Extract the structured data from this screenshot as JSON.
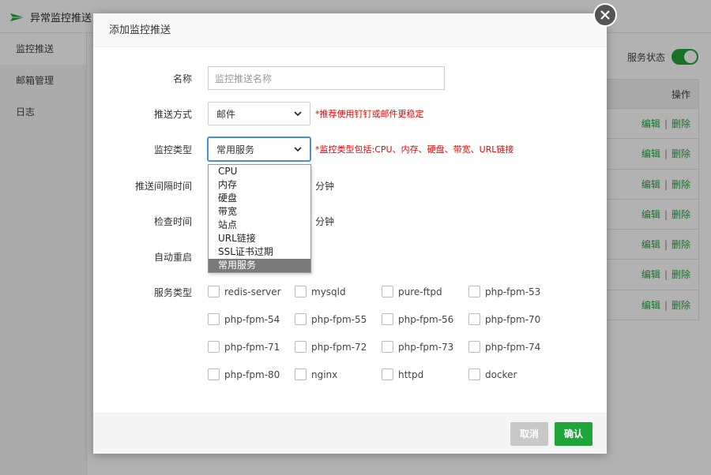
{
  "app": {
    "title": "异常监控推送",
    "sidebar": [
      "监控推送",
      "邮箱管理",
      "日志"
    ],
    "service_status_label": "服务状态",
    "table": {
      "header": "操作",
      "rows": [
        {
          "edit": "编辑",
          "delete": "删除"
        },
        {
          "edit": "编辑",
          "delete": "删除"
        },
        {
          "edit": "编辑",
          "delete": "删除"
        },
        {
          "edit": "编辑",
          "delete": "删除"
        },
        {
          "edit": "编辑",
          "delete": "删除"
        },
        {
          "edit": "编辑",
          "delete": "删除"
        },
        {
          "edit": "编辑",
          "delete": "删除"
        }
      ]
    }
  },
  "modal": {
    "title": "添加监控推送",
    "fields": {
      "name": {
        "label": "名称",
        "placeholder": "监控推送名称"
      },
      "push_method": {
        "label": "推送方式",
        "value": "邮件",
        "hint": "*推荐使用钉钉或邮件更稳定"
      },
      "monitor_type": {
        "label": "监控类型",
        "value": "常用服务",
        "hint": "*监控类型包括:CPU、内存、硬盘、带宽、URL链接"
      },
      "push_interval": {
        "label": "推送间隔时间",
        "unit": "分钟"
      },
      "check_time": {
        "label": "检查时间",
        "unit": "分钟"
      },
      "auto_restart": {
        "label": "自动重启"
      },
      "service_type": {
        "label": "服务类型"
      }
    },
    "monitor_type_options": [
      "CPU",
      "内存",
      "硬盘",
      "带宽",
      "站点",
      "URL链接",
      "SSL证书过期",
      "常用服务"
    ],
    "services": [
      "redis-server",
      "mysqld",
      "pure-ftpd",
      "php-fpm-53",
      "php-fpm-54",
      "php-fpm-55",
      "php-fpm-56",
      "php-fpm-70",
      "php-fpm-71",
      "php-fpm-72",
      "php-fpm-73",
      "php-fpm-74",
      "php-fpm-80",
      "nginx",
      "httpd",
      "docker"
    ],
    "buttons": {
      "cancel": "取消",
      "confirm": "确认"
    }
  },
  "colors": {
    "accent": "#20a53a",
    "hint": "#ee0000",
    "overlay": "rgba(0,0,0,0.30)"
  }
}
